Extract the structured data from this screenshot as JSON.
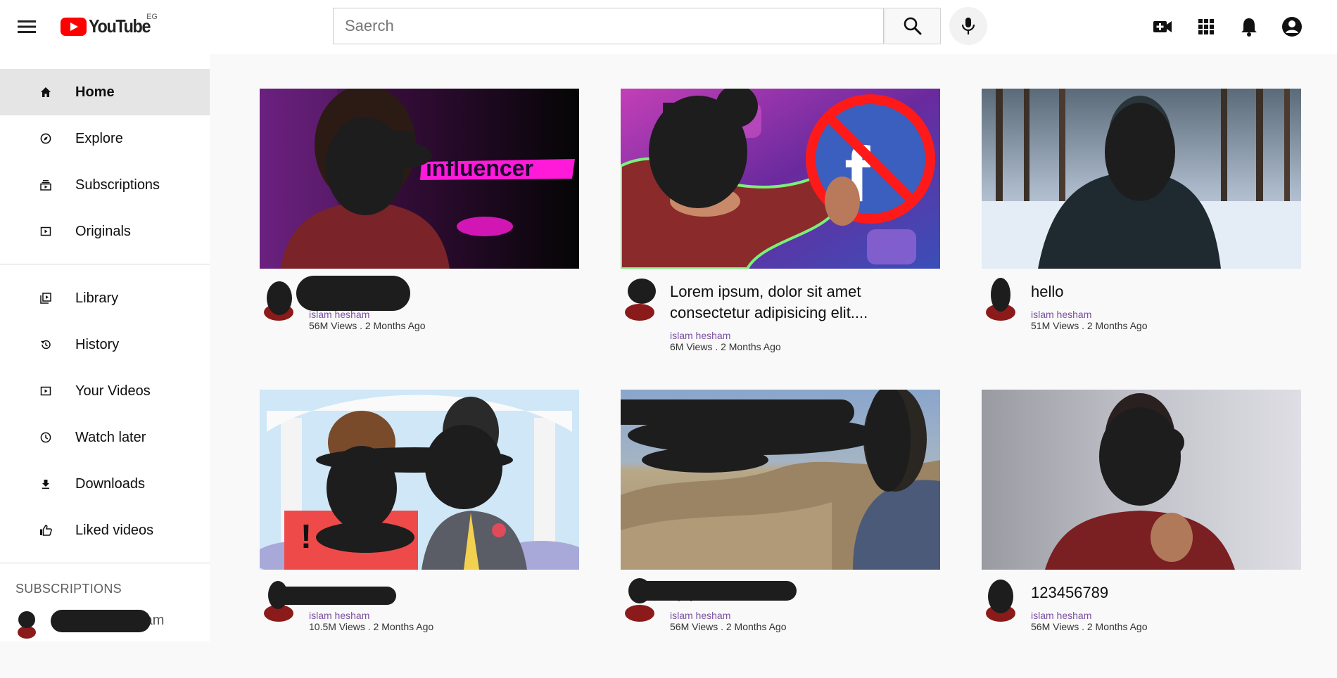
{
  "header": {
    "logo_text": "YouTube",
    "region": "EG",
    "search": {
      "placeholder": "Saerch",
      "value": ""
    }
  },
  "icons": {
    "menu": "menu-icon",
    "search": "search-icon",
    "mic": "mic-icon",
    "create": "video-add-icon",
    "apps": "apps-grid-icon",
    "notifications": "bell-icon",
    "account": "account-icon"
  },
  "sidebar": {
    "primary": [
      {
        "label": "Home",
        "icon": "home-icon",
        "active": true
      },
      {
        "label": "Explore",
        "icon": "compass-icon"
      },
      {
        "label": "Subscriptions",
        "icon": "subscriptions-icon"
      },
      {
        "label": "Originals",
        "icon": "originals-icon"
      }
    ],
    "secondary": [
      {
        "label": "Library",
        "icon": "library-icon"
      },
      {
        "label": "History",
        "icon": "history-icon"
      },
      {
        "label": "Your Videos",
        "icon": "your-videos-icon"
      },
      {
        "label": "Watch later",
        "icon": "clock-icon"
      },
      {
        "label": "Downloads",
        "icon": "download-icon"
      },
      {
        "label": "Liked videos",
        "icon": "thumbs-up-icon"
      }
    ],
    "subscriptions_heading": "SUBSCRIPTIONS",
    "subscription_items": [
      {
        "name": "islam hesham"
      }
    ]
  },
  "videos": [
    {
      "title": "",
      "channel": "islam hesham",
      "meta": "56M Views . 2 Months Ago"
    },
    {
      "title": "Lorem ipsum, dolor sit amet consectetur adipisicing elit....",
      "channel": "islam hesham",
      "meta": "6M Views . 2 Months Ago"
    },
    {
      "title": "hello",
      "channel": "islam hesham",
      "meta": "51M Views . 2 Months Ago"
    },
    {
      "title": "",
      "channel": "islam hesham",
      "meta": "10.5M Views . 2 Months Ago"
    },
    {
      "title": "hjhjhuhuhh12345",
      "channel": "islam hesham",
      "meta": "56M Views . 2 Months Ago"
    },
    {
      "title": "123456789",
      "channel": "islam hesham",
      "meta": "56M Views . 2 Months Ago"
    }
  ],
  "thumbnail_overlays": {
    "video_0": "influencer",
    "video_1": "f"
  },
  "colors": {
    "brand_red": "#ff0000",
    "channel_name": "#7b4fa0",
    "active_nav": "#e5e5e5",
    "redaction": "#1d1d1d"
  }
}
